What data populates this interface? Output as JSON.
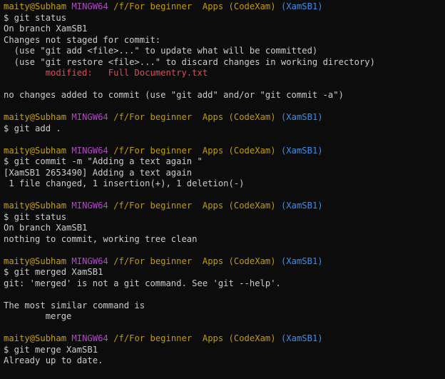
{
  "colors": {
    "background": "#0c0c0c",
    "text": "#cccccc",
    "user": "#c4a000",
    "env": "#b148c6",
    "path": "#c19c00",
    "branch": "#3b8eea",
    "modified": "#e74856"
  },
  "prompt": {
    "user_host": "maity@Subham",
    "env": "MINGW64",
    "path": "/f/For beginner  Apps (CodeXam)",
    "branch": "(XamSB1)"
  },
  "lines": [
    {
      "type": "prompt"
    },
    {
      "type": "text",
      "text": "$ git status"
    },
    {
      "type": "text",
      "text": "On branch XamSB1"
    },
    {
      "type": "text",
      "text": "Changes not staged for commit:"
    },
    {
      "type": "text",
      "text": "  (use \"git add <file>...\" to update what will be committed)"
    },
    {
      "type": "text",
      "text": "  (use \"git restore <file>...\" to discard changes in working directory)"
    },
    {
      "type": "modified",
      "text": "        modified:   Full Documentry.txt"
    },
    {
      "type": "blank"
    },
    {
      "type": "text",
      "text": "no changes added to commit (use \"git add\" and/or \"git commit -a\")"
    },
    {
      "type": "blank"
    },
    {
      "type": "prompt"
    },
    {
      "type": "text",
      "text": "$ git add ."
    },
    {
      "type": "blank"
    },
    {
      "type": "prompt"
    },
    {
      "type": "text",
      "text": "$ git commit -m \"Adding a text again \""
    },
    {
      "type": "text",
      "text": "[XamSB1 2653490] Adding a text again"
    },
    {
      "type": "text",
      "text": " 1 file changed, 1 insertion(+), 1 deletion(-)"
    },
    {
      "type": "blank"
    },
    {
      "type": "prompt"
    },
    {
      "type": "text",
      "text": "$ git status"
    },
    {
      "type": "text",
      "text": "On branch XamSB1"
    },
    {
      "type": "text",
      "text": "nothing to commit, working tree clean"
    },
    {
      "type": "blank"
    },
    {
      "type": "prompt"
    },
    {
      "type": "text",
      "text": "$ git merged XamSB1"
    },
    {
      "type": "text",
      "text": "git: 'merged' is not a git command. See 'git --help'."
    },
    {
      "type": "blank"
    },
    {
      "type": "text",
      "text": "The most similar command is"
    },
    {
      "type": "text",
      "text": "        merge"
    },
    {
      "type": "blank"
    },
    {
      "type": "prompt"
    },
    {
      "type": "text",
      "text": "$ git merge XamSB1"
    },
    {
      "type": "text",
      "text": "Already up to date."
    }
  ]
}
